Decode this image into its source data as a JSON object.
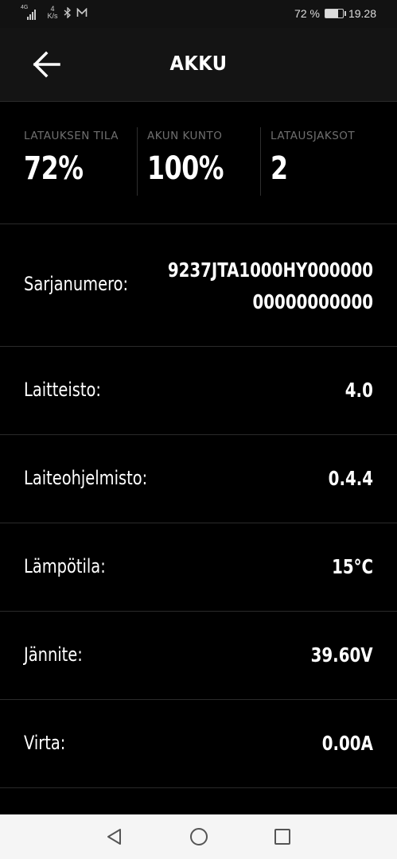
{
  "statusbar": {
    "network": "4G",
    "speed_value": "4",
    "speed_unit": "K/s",
    "battery_percent": "72 %",
    "battery_level": 0.72,
    "time": "19.28"
  },
  "header": {
    "title": "AKKU"
  },
  "stats": [
    {
      "label": "LATAUKSEN TILA",
      "value": "72%"
    },
    {
      "label": "AKUN KUNTO",
      "value": "100%"
    },
    {
      "label": "LATAUSJAKSOT",
      "value": "2"
    }
  ],
  "details": {
    "serial": {
      "label": "Sarjanumero:",
      "value_line1": "9237JTA1000HY000000",
      "value_line2": "00000000000"
    },
    "hardware": {
      "label": "Laitteisto:",
      "value": "4.0"
    },
    "firmware": {
      "label": "Laiteohjelmisto:",
      "value": "0.4.4"
    },
    "temperature": {
      "label": "Lämpötila:",
      "value": "15°C"
    },
    "voltage": {
      "label": "Jännite:",
      "value": "39.60V"
    },
    "current": {
      "label": "Virta:",
      "value": "0.00A"
    }
  },
  "icons": {
    "back": "arrow-left-icon",
    "bluetooth": "bluetooth-icon",
    "mail": "mail-icon",
    "nav_back": "triangle-back-icon",
    "nav_home": "circle-home-icon",
    "nav_recents": "square-recents-icon"
  }
}
